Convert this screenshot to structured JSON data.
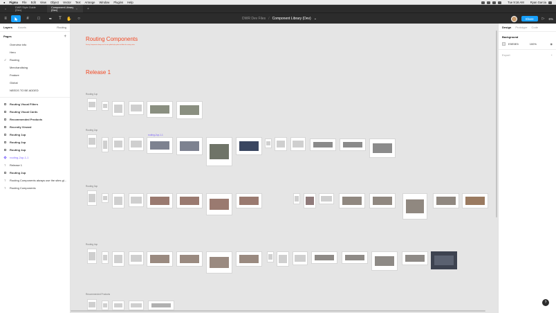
{
  "menubar": {
    "app": "Figma",
    "items": [
      "File",
      "Edit",
      "View",
      "Object",
      "Vector",
      "Text",
      "Arrange",
      "Window",
      "Plugins",
      "Help"
    ],
    "clock": "Tue 9:16 AM",
    "user": "Ryan Garcia"
  },
  "tabs": [
    {
      "label": "DWR Style Guide (Dev)"
    },
    {
      "label": "Component Library (Dev)"
    }
  ],
  "toolbar": {
    "project": "DWR Dev Files",
    "file": "Component Library (Dev)",
    "share": "Share",
    "zoom": "6%"
  },
  "left_panel": {
    "tab_layers": "Layers",
    "tab_assets": "Assets",
    "page_selector": "Routing",
    "pages_title": "Pages",
    "pages": [
      "Overview info",
      "Hero",
      "Routing",
      "Merchandising",
      "Feature",
      "Global",
      "NEEDS TO BE ADDED"
    ],
    "current_page": "Routing",
    "layers": [
      {
        "label": "Routing Visual Filters",
        "kind": "frame"
      },
      {
        "label": "Routing Visual Cards",
        "kind": "frame"
      },
      {
        "label": "Recommended Products",
        "kind": "frame"
      },
      {
        "label": "Recently Viewed",
        "kind": "frame"
      },
      {
        "label": "Routing 1up",
        "kind": "frame"
      },
      {
        "label": "Routing 2up",
        "kind": "frame"
      },
      {
        "label": "Routing 4up",
        "kind": "frame"
      },
      {
        "label": "routing-2up-1-1",
        "kind": "component"
      },
      {
        "label": "Release 1",
        "kind": "text"
      },
      {
        "label": "Routing 2up",
        "kind": "frame"
      },
      {
        "label": "Routing Components always use the sites gl...",
        "kind": "text"
      },
      {
        "label": "Routing Components",
        "kind": "text"
      }
    ]
  },
  "right_panel": {
    "tab_design": "Design",
    "tab_prototype": "Prototype",
    "tab_code": "Code",
    "bg_title": "Background",
    "bg_hex": "E5E5E5",
    "bg_opacity": "100%",
    "export": "Export"
  },
  "canvas": {
    "title": "Routing Components",
    "subtitle": "Routing Components always use the sites global style guide and follow the routing colors",
    "release": "Release 1",
    "sections": [
      "Routing 1up",
      "Routing 2up",
      "Routing 3up",
      "Routing 4up",
      "Recommended Products"
    ],
    "component_label": "routing-2up-1-1"
  },
  "colors": {
    "accent": "#18a0fb",
    "heading": "#f24822",
    "component": "#7b61ff"
  }
}
